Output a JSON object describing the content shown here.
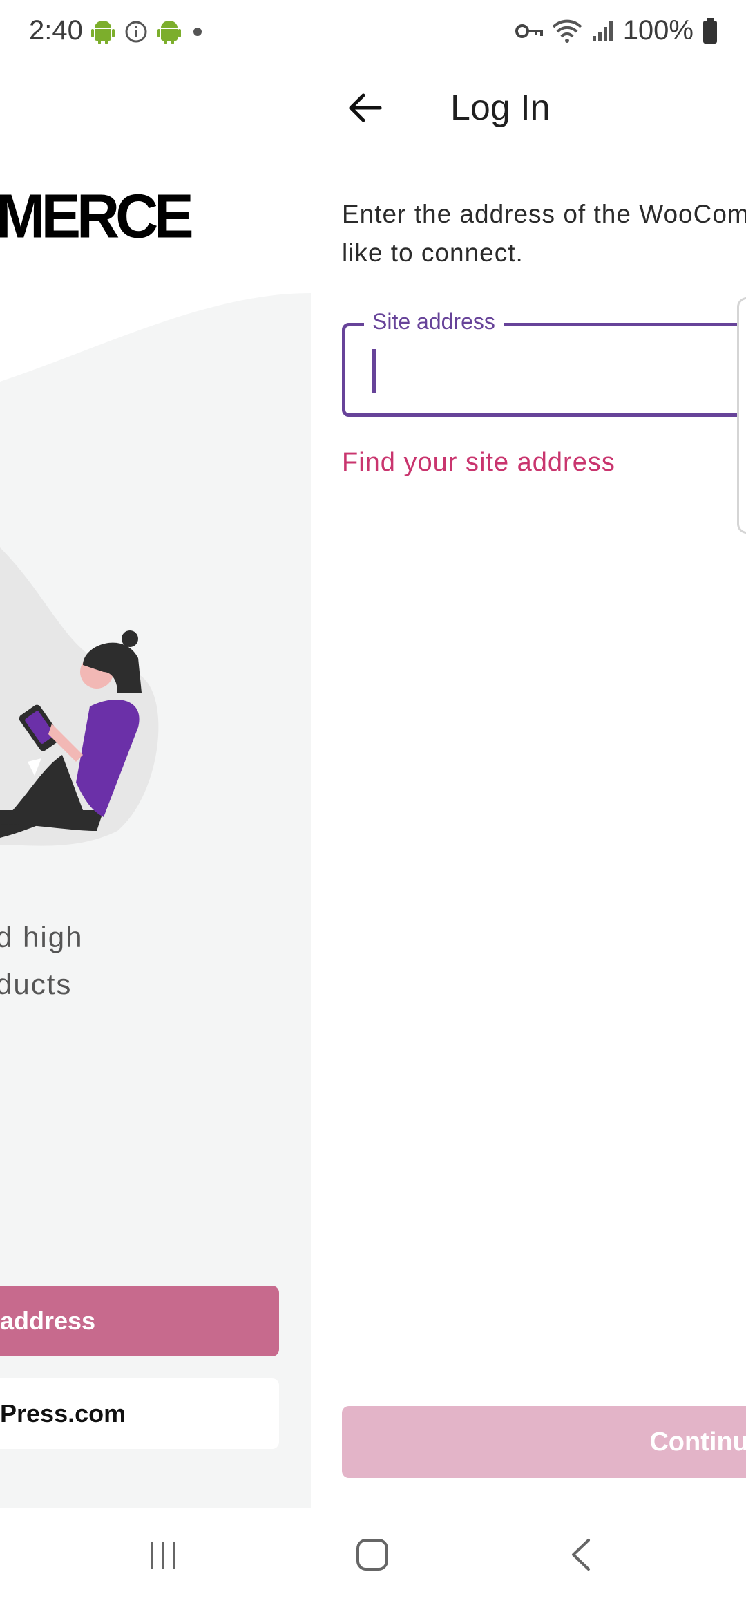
{
  "status_bar": {
    "time": "2:40",
    "battery_text": "100%",
    "left_icons": [
      "android-icon",
      "info-icon",
      "android-icon",
      "dot-icon"
    ],
    "right_icons": [
      "key-icon",
      "wifi-icon",
      "signal-icon",
      "battery-icon"
    ]
  },
  "background_screen": {
    "wordmark": "MERCE",
    "tagline_line1": "d high",
    "tagline_line2": "ducts",
    "primary_button": "address",
    "secondary_button": "Press.com"
  },
  "login": {
    "title": "Log In",
    "instructions": "Enter the address of the WooCommerce store you'd like to connect.",
    "instructions_visible_line1": "Enter the address of the WooCom",
    "instructions_visible_line2": "like to connect.",
    "field_label": "Site address",
    "field_value": "",
    "find_link": "Find your site address",
    "continue_label": "Continue"
  },
  "colors": {
    "accent_purple": "#674399",
    "link_pink": "#c9356e",
    "primary_button": "#c76a8d",
    "continue_disabled": "#e3b4c8"
  },
  "nav_bar": {
    "buttons": [
      "recent-apps-icon",
      "home-icon",
      "back-icon"
    ]
  }
}
